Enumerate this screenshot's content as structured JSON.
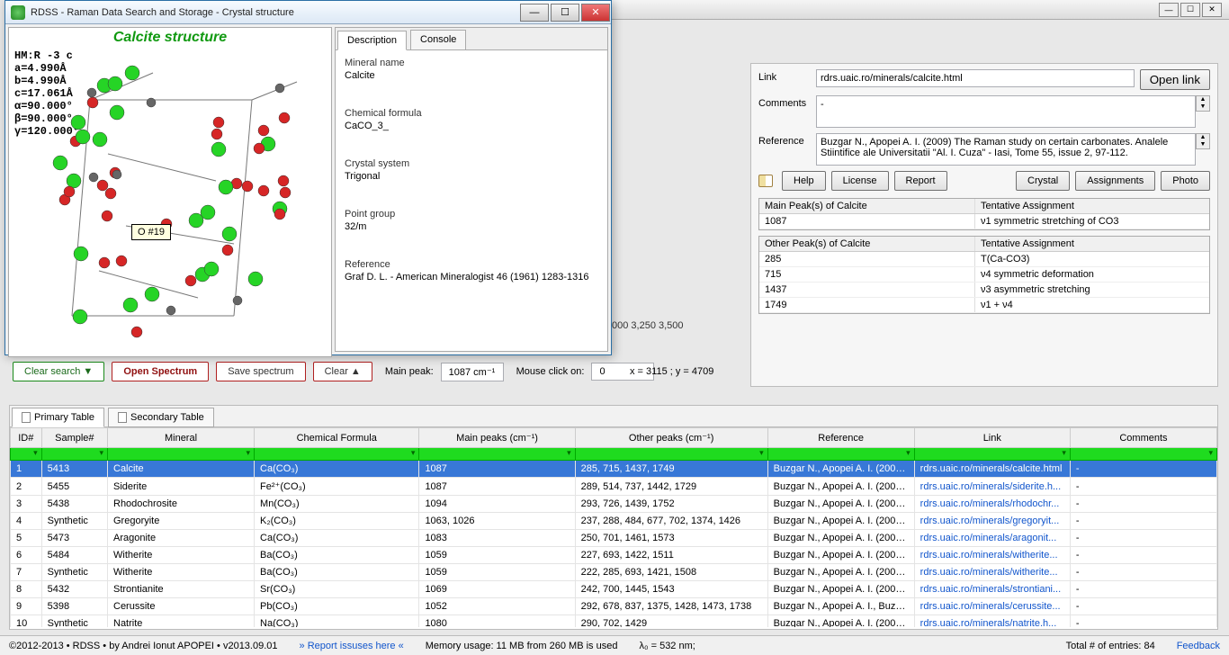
{
  "outer_window": {
    "min": "—",
    "max": "☐",
    "close": "✕"
  },
  "crystal_window": {
    "title": "RDSS - Raman Data Search and Storage - Crystal structure",
    "btn_min": "—",
    "btn_max": "☐",
    "btn_close": "✕",
    "structure_title": "Calcite structure",
    "params": [
      "HM:R -3 c",
      "a=4.990Å",
      "b=4.990Å",
      "c=17.061Å",
      "α=90.000°",
      "β=90.000°",
      "γ=120.000°"
    ],
    "atom_tooltip": "O #19",
    "tabs": {
      "description": "Description",
      "console": "Console"
    },
    "desc": {
      "name_label": "Mineral name",
      "name": "Calcite",
      "formula_label": "Chemical formula",
      "formula": "CaCO_3_",
      "system_label": "Crystal system",
      "system": "Trigonal",
      "pointgroup_label": "Point group",
      "pointgroup": "32/m",
      "ref_label": "Reference",
      "ref": "Graf D. L. - American Mineralogist 46 (1961) 1283-1316"
    }
  },
  "info": {
    "link_label": "Link",
    "link_value": "rdrs.uaic.ro/minerals/calcite.html",
    "open_link": "Open link",
    "comments_label": "Comments",
    "comments_value": "-",
    "reference_label": "Reference",
    "reference_value": "Buzgar N., Apopei A. I. (2009) The Raman study on certain carbonates. Analele Stiintifice ale Universitatii \"Al. I. Cuza\" - Iasi, Tome 55, issue 2, 97-112.",
    "buttons": {
      "help": "Help",
      "license": "License",
      "report": "Report",
      "crystal": "Crystal",
      "assignments": "Assignments",
      "photo": "Photo"
    },
    "main_peak": {
      "col1": "Main Peak(s) of Calcite",
      "col2": "Tentative Assignment",
      "rows": [
        {
          "p": "1087",
          "a": "ν1 symmetric stretching of CO3"
        }
      ]
    },
    "other_peak": {
      "col1": "Other Peak(s) of Calcite",
      "col2": "Tentative Assignment",
      "rows": [
        {
          "p": "285",
          "a": "T(Ca-CO3)"
        },
        {
          "p": "715",
          "a": "ν4 symmetric deformation"
        },
        {
          "p": "1437",
          "a": "ν3 asymmetric stretching"
        },
        {
          "p": "1749",
          "a": "ν1 + ν4"
        }
      ]
    }
  },
  "toolstrip": {
    "clear_search": "Clear search ▼",
    "open_spectrum": "Open Spectrum",
    "save_spectrum": "Save spectrum",
    "clear": "Clear ▲",
    "main_peak_label": "Main peak:",
    "main_peak_value": "1087 cm⁻¹",
    "mouse_label": "Mouse click on:",
    "mouse_value": "0",
    "xy": "x = 3115 ; y = 4709"
  },
  "bg_ticks": "000    3,250   3,500",
  "table_tabs": {
    "primary": "Primary Table",
    "secondary": "Secondary Table"
  },
  "columns": [
    "ID#",
    "Sample#",
    "Mineral",
    "Chemical Formula",
    "Main peaks (cm⁻¹)",
    "Other peaks (cm⁻¹)",
    "Reference",
    "Link",
    "Comments"
  ],
  "rows": [
    {
      "id": "1",
      "sample": "5413",
      "mineral": "Calcite",
      "formula": "Ca(CO₃)",
      "main": "1087",
      "other": "285, 715, 1437, 1749",
      "ref": "Buzgar N., Apopei A. I. (2009...",
      "link": "rdrs.uaic.ro/minerals/calcite.html",
      "comm": "-",
      "sel": true
    },
    {
      "id": "2",
      "sample": "5455",
      "mineral": "Siderite",
      "formula": "Fe²⁺(CO₃)",
      "main": "1087",
      "other": "289, 514, 737, 1442, 1729",
      "ref": "Buzgar N., Apopei A. I. (2009...",
      "link": "rdrs.uaic.ro/minerals/siderite.h...",
      "comm": "-"
    },
    {
      "id": "3",
      "sample": "5438",
      "mineral": "Rhodochrosite",
      "formula": "Mn(CO₃)",
      "main": "1094",
      "other": "293, 726, 1439, 1752",
      "ref": "Buzgar N., Apopei A. I. (2009...",
      "link": "rdrs.uaic.ro/minerals/rhodochr...",
      "comm": "-"
    },
    {
      "id": "4",
      "sample": "Synthetic",
      "mineral": "Gregoryite",
      "formula": "K₂(CO₃)",
      "main": "1063, 1026",
      "other": "237, 288, 484, 677, 702, 1374, 1426",
      "ref": "Buzgar N., Apopei A. I. (2009...",
      "link": "rdrs.uaic.ro/minerals/gregoryit...",
      "comm": "-"
    },
    {
      "id": "5",
      "sample": "5473",
      "mineral": "Aragonite",
      "formula": "Ca(CO₃)",
      "main": "1083",
      "other": "250, 701, 1461, 1573",
      "ref": "Buzgar N., Apopei A. I. (2009...",
      "link": "rdrs.uaic.ro/minerals/aragonit...",
      "comm": "-"
    },
    {
      "id": "6",
      "sample": "5484",
      "mineral": "Witherite",
      "formula": "Ba(CO₃)",
      "main": "1059",
      "other": "227, 693, 1422, 1511",
      "ref": "Buzgar N., Apopei A. I. (2009...",
      "link": "rdrs.uaic.ro/minerals/witherite...",
      "comm": "-"
    },
    {
      "id": "7",
      "sample": "Synthetic",
      "mineral": "Witherite",
      "formula": "Ba(CO₃)",
      "main": "1059",
      "other": "222, 285, 693, 1421, 1508",
      "ref": "Buzgar N., Apopei A. I. (2009...",
      "link": "rdrs.uaic.ro/minerals/witherite...",
      "comm": "-"
    },
    {
      "id": "8",
      "sample": "5432",
      "mineral": "Strontianite",
      "formula": "Sr(CO₃)",
      "main": "1069",
      "other": "242, 700, 1445, 1543",
      "ref": "Buzgar N., Apopei A. I. (2009...",
      "link": "rdrs.uaic.ro/minerals/strontiani...",
      "comm": "-"
    },
    {
      "id": "9",
      "sample": "5398",
      "mineral": "Cerussite",
      "formula": "Pb(CO₃)",
      "main": "1052",
      "other": "292, 678, 837, 1375, 1428, 1473, 1738",
      "ref": "Buzgar N., Apopei A. I., Buza...",
      "link": "rdrs.uaic.ro/minerals/cerussite...",
      "comm": "-"
    },
    {
      "id": "10",
      "sample": "Synthetic",
      "mineral": "Natrite",
      "formula": "Na(CO₃)",
      "main": "1080",
      "other": "290, 702, 1429",
      "ref": "Buzgar N., Apopei A. I. (2009...",
      "link": "rdrs.uaic.ro/minerals/natrite.h...",
      "comm": "-"
    }
  ],
  "status": {
    "copyright": "©2012-2013 • RDSS • by Andrei Ionut APOPEI • v2013.09.01",
    "report": "» Report issuses here «",
    "mem": "Memory usage: 11 MB from 260 MB is used",
    "lambda": "λ₀ = 532 nm;",
    "total": "Total # of entries: 84",
    "feedback": "Feedback"
  }
}
